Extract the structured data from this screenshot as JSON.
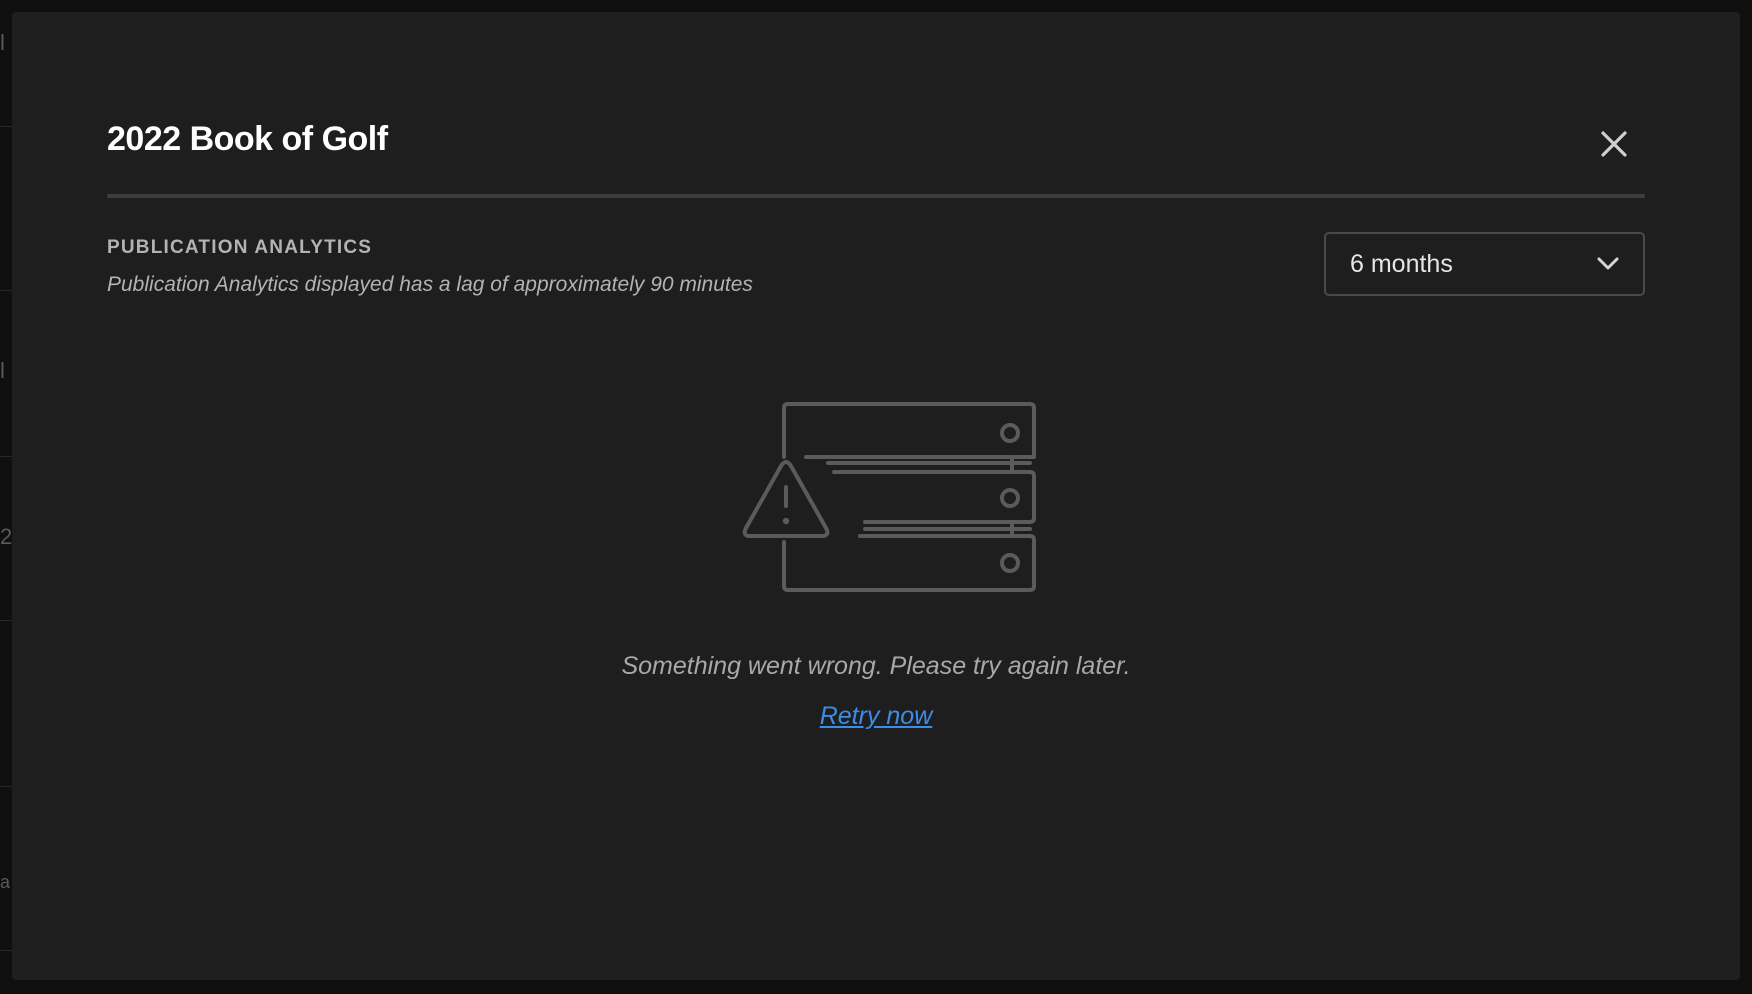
{
  "modal": {
    "title": "2022 Book of Golf",
    "close_icon": "close-icon"
  },
  "analytics": {
    "heading": "PUBLICATION ANALYTICS",
    "subtitle": "Publication Analytics displayed has a lag of approximately 90 minutes"
  },
  "range_select": {
    "value": "6 months",
    "icon": "chevron-down-icon"
  },
  "error_state": {
    "illustration_icon": "server-warning-icon",
    "message": "Something went wrong. Please try again later.",
    "retry_label": "Retry now",
    "link_color": "#3b8de8"
  },
  "background": {
    "fragments": [
      "l",
      "l",
      "2",
      "a"
    ]
  }
}
